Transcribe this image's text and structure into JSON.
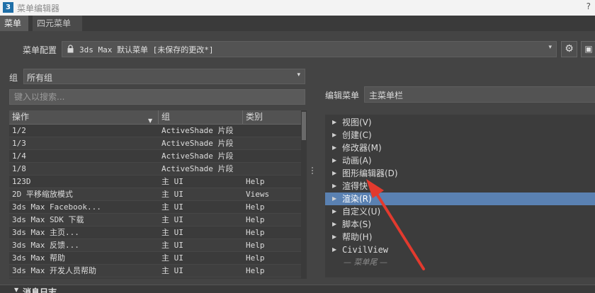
{
  "window": {
    "title": "菜单编辑器",
    "app_icon_text": "3",
    "help_glyph": "?"
  },
  "tabs": [
    {
      "label": "菜单"
    },
    {
      "label": "四元菜单"
    }
  ],
  "menu_config": {
    "label": "菜单配置",
    "value": "3ds Max 默认菜单 [未保存的更改*]",
    "dropdown_icon": "▾",
    "lock_icon": "lock-icon",
    "gear_icon": "⚙",
    "save_icon": "▣"
  },
  "group": {
    "label": "组",
    "value": "所有组",
    "dropdown_icon": "▾"
  },
  "search": {
    "placeholder": "键入以搜索..."
  },
  "table": {
    "headers": [
      "操作",
      "组",
      "类别"
    ],
    "sort_icon": "▼",
    "rows": [
      [
        "1/2",
        "ActiveShade 片段",
        ""
      ],
      [
        "1/3",
        "ActiveShade 片段",
        ""
      ],
      [
        "1/4",
        "ActiveShade 片段",
        ""
      ],
      [
        "1/8",
        "ActiveShade 片段",
        ""
      ],
      [
        "123D",
        "主 UI",
        "Help"
      ],
      [
        "2D 平移缩放模式",
        "主 UI",
        "Views"
      ],
      [
        "3ds Max Facebook...",
        "主 UI",
        "Help"
      ],
      [
        "3ds Max SDK 下载",
        "主 UI",
        "Help"
      ],
      [
        "3ds Max 主页...",
        "主 UI",
        "Help"
      ],
      [
        "3ds Max 反馈...",
        "主 UI",
        "Help"
      ],
      [
        "3ds Max 帮助",
        "主 UI",
        "Help"
      ],
      [
        "3ds Max 开发人员帮助",
        "主 UI",
        "Help"
      ]
    ]
  },
  "edit_menu": {
    "label": "编辑菜单",
    "value": "主菜单栏"
  },
  "tree": {
    "expand_icon": "▶",
    "items": [
      {
        "label": "视图(V)",
        "selected": false
      },
      {
        "label": "创建(C)",
        "selected": false
      },
      {
        "label": "修改器(M)",
        "selected": false
      },
      {
        "label": "动画(A)",
        "selected": false
      },
      {
        "label": "图形编辑器(D)",
        "selected": false
      },
      {
        "label": "渲得快",
        "selected": false
      },
      {
        "label": "渲染(R)",
        "selected": true
      },
      {
        "label": "自定义(U)",
        "selected": false
      },
      {
        "label": "脚本(S)",
        "selected": false
      },
      {
        "label": "帮助(H)",
        "selected": false
      },
      {
        "label": "CivilView",
        "selected": false
      }
    ],
    "end_marker": "— 菜单尾 —"
  },
  "log": {
    "label": "消息日志",
    "collapse_icon": "▼"
  },
  "colors": {
    "selection": "#5a81b2",
    "annotation_arrow": "#e23a2e"
  }
}
